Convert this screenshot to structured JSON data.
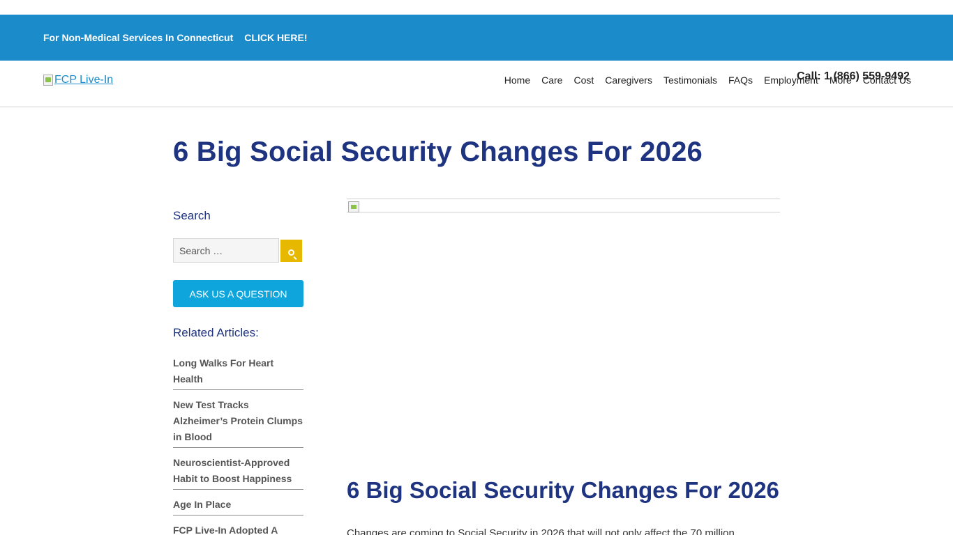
{
  "topbar": {
    "promo_text": "For Non-Medical Services In Connecticut",
    "promo_link": "CLICK HERE!"
  },
  "header": {
    "logo_alt": "FCP Live-In",
    "phone": "Call: 1 (866) 559-9492",
    "nav": [
      "Home",
      "Care",
      "Cost",
      "Caregivers",
      "Testimonials",
      "FAQs",
      "Employment",
      "More",
      "Contact Us"
    ]
  },
  "page": {
    "title": "6 Big Social Security Changes For 2026"
  },
  "sidebar": {
    "search_heading": "Search",
    "search_placeholder": "Search …",
    "ask_button": "ASK US A QUESTION",
    "related_heading": "Related Articles:",
    "related": [
      "Long Walks For Heart Health",
      "New Test Tracks Alzheimer’s Protein Clumps in Blood",
      "Neuroscientist-Approved Habit to Boost Happiness",
      "Age In Place",
      "FCP Live-In Adopted A"
    ]
  },
  "article": {
    "title": "6 Big Social Security Changes For 2026",
    "intro": "Changes are coming to Social Security in 2026 that will not only affect the 70 million"
  },
  "icons": {
    "search": "search-icon",
    "broken_image": "broken-image-icon"
  }
}
